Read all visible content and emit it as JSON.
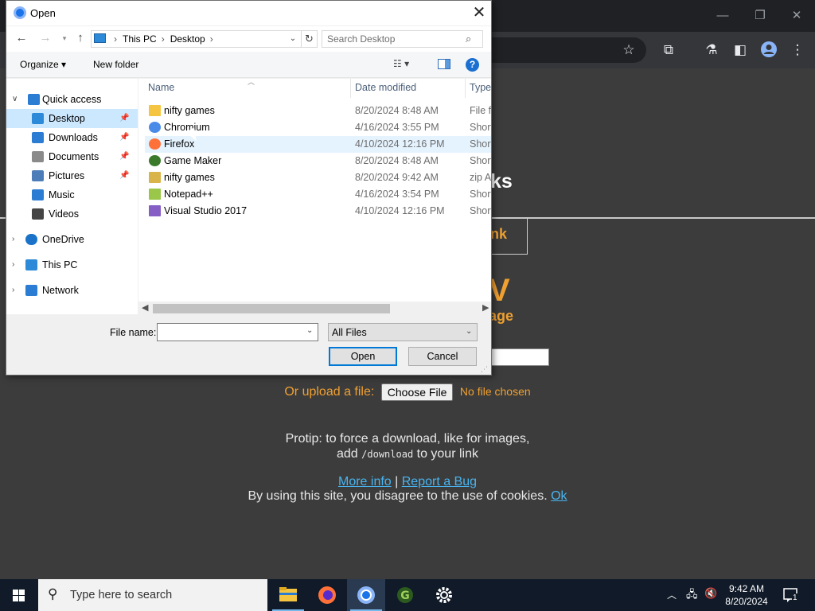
{
  "browser": {
    "window_controls": [
      "minimize",
      "restore",
      "close"
    ],
    "toolbar_icons": [
      "star-icon",
      "extensions-icon",
      "labs-icon",
      "side-panel-icon",
      "profile-icon",
      "menu-icon"
    ],
    "site_title_fragment": "ks",
    "link_button_fragment": "nk",
    "big_letter_fragment": "V",
    "subtitle_fragment": "age",
    "upload": {
      "label": "Or upload a file:",
      "button": "Choose File",
      "status": "No file chosen"
    },
    "protip": {
      "line1": "Protip: to force a download, like for images,",
      "line2_before": "add ",
      "line2_code": "/download",
      "line2_after": " to your link"
    },
    "links": {
      "more_info": "More info",
      "separator": " | ",
      "report_bug": "Report a Bug"
    },
    "cookie": {
      "text": "By using this site, you disagree to the use of cookies. ",
      "ok": "Ok"
    },
    "colors": {
      "accent": "#f0a030",
      "link": "#48b4f0",
      "page_bg": "#3c3c3c"
    }
  },
  "dialog": {
    "title": "Open",
    "address": {
      "root": "This PC",
      "folder": "Desktop"
    },
    "search_placeholder": "Search Desktop",
    "commands": {
      "organize": "Organize ▾",
      "new_folder": "New folder",
      "help": "?"
    },
    "nav_pane": [
      {
        "label": "Quick access",
        "icon": "star-icon",
        "color": "#2b7cd3"
      },
      {
        "label": "Desktop",
        "icon": "desktop-icon",
        "color": "#2d8ad8",
        "pinned": true,
        "selected": true
      },
      {
        "label": "Downloads",
        "icon": "download-icon",
        "color": "#2b7cd3",
        "pinned": true
      },
      {
        "label": "Documents",
        "icon": "documents-icon",
        "color": "#8a8a8a",
        "pinned": true
      },
      {
        "label": "Pictures",
        "icon": "pictures-icon",
        "color": "#4c7db8",
        "pinned": true
      },
      {
        "label": "Music",
        "icon": "music-icon",
        "color": "#2b7cd3"
      },
      {
        "label": "Videos",
        "icon": "videos-icon",
        "color": "#444444"
      },
      {
        "label": "OneDrive",
        "icon": "onedrive-icon",
        "color": "#1a73c8"
      },
      {
        "label": "This PC",
        "icon": "computer-icon",
        "color": "#2d8ad8"
      },
      {
        "label": "Network",
        "icon": "network-icon",
        "color": "#2b7cd3"
      }
    ],
    "columns": {
      "name": "Name",
      "date": "Date modified",
      "type": "Type"
    },
    "files": [
      {
        "name": "nifty games",
        "date": "8/20/2024 8:48 AM",
        "type": "File fo",
        "icon": "folder-icon",
        "color": "#f5c542"
      },
      {
        "name": "Chromium",
        "date": "4/16/2024 3:55 PM",
        "type": "Short",
        "icon": "chromium-icon",
        "color": "#4a8ae8"
      },
      {
        "name": "Firefox",
        "date": "4/10/2024 12:16 PM",
        "type": "Short",
        "icon": "firefox-icon",
        "color": "#ff7139",
        "hover": true
      },
      {
        "name": "Game Maker",
        "date": "8/20/2024 8:48 AM",
        "type": "Short",
        "icon": "gamemaker-icon",
        "color": "#3a7a2a"
      },
      {
        "name": "nifty games",
        "date": "8/20/2024 9:42 AM",
        "type": "zip A",
        "icon": "zip-icon",
        "color": "#d9b44a"
      },
      {
        "name": "Notepad++",
        "date": "4/16/2024 3:54 PM",
        "type": "Short",
        "icon": "notepadpp-icon",
        "color": "#9ac64a"
      },
      {
        "name": "Visual Studio 2017",
        "date": "4/10/2024 12:16 PM",
        "type": "Short",
        "icon": "visualstudio-icon",
        "color": "#865fc5"
      }
    ],
    "file_name": {
      "label": "File name:",
      "value": ""
    },
    "file_type": "All Files",
    "buttons": {
      "open": "Open",
      "cancel": "Cancel"
    }
  },
  "taskbar": {
    "search_placeholder": "Type here to search",
    "apps": [
      "file-explorer-icon",
      "firefox-icon",
      "chromium-icon",
      "gamemaker-icon",
      "settings-icon"
    ],
    "clock": {
      "time": "9:42 AM",
      "date": "8/20/2024"
    },
    "notification_count": "1"
  }
}
